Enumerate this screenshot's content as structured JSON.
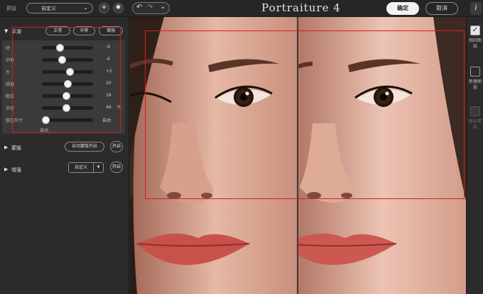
{
  "toolbar": {
    "preset_label": "预设",
    "preset_value": "自定义",
    "add_icon": "+",
    "settings_icon": "✱",
    "undo_icon": "↶",
    "redo_icon": "↷",
    "history_icon": "⌄",
    "brand": "Portraiture 4",
    "ok_label": "确定",
    "cancel_label": "取消",
    "info_label": "i"
  },
  "smoothing": {
    "title": "平滑",
    "presets": [
      "正常",
      "中等",
      "增强"
    ],
    "sliders": [
      {
        "label": "好",
        "value": "-9",
        "unit": "",
        "fraction": 0.32
      },
      {
        "label": "中等",
        "value": "-6",
        "unit": "",
        "fraction": 0.38
      },
      {
        "label": "大",
        "value": "+2",
        "unit": "",
        "fraction": 0.56
      },
      {
        "label": "阈值",
        "value": "20",
        "unit": "",
        "fraction": 0.5
      },
      {
        "label": "阻白",
        "value": "18",
        "unit": "",
        "fraction": 0.48
      },
      {
        "label": "半径",
        "value": "48",
        "unit": "%",
        "fraction": 0.48
      },
      {
        "label": "肤区尺寸",
        "value": "自动",
        "unit": "",
        "fraction": 0.0
      }
    ],
    "auto_label": "自动"
  },
  "mask": {
    "title": "蒙版",
    "auto_mask_label": "自动蒙版开启",
    "toggle_label": "开启"
  },
  "enhance": {
    "title": "增强",
    "dropdown_value": "自定义",
    "dropdown_icon": "▼",
    "toggle_label": "开启"
  },
  "right": {
    "same_layer_check": "✓",
    "same_layer": "相同图层",
    "new_layer": "新建图层",
    "output_mask": "输出蒙版"
  },
  "colors": {
    "accent_red": "#d32020",
    "panel_bg": "#2b2b2b"
  }
}
